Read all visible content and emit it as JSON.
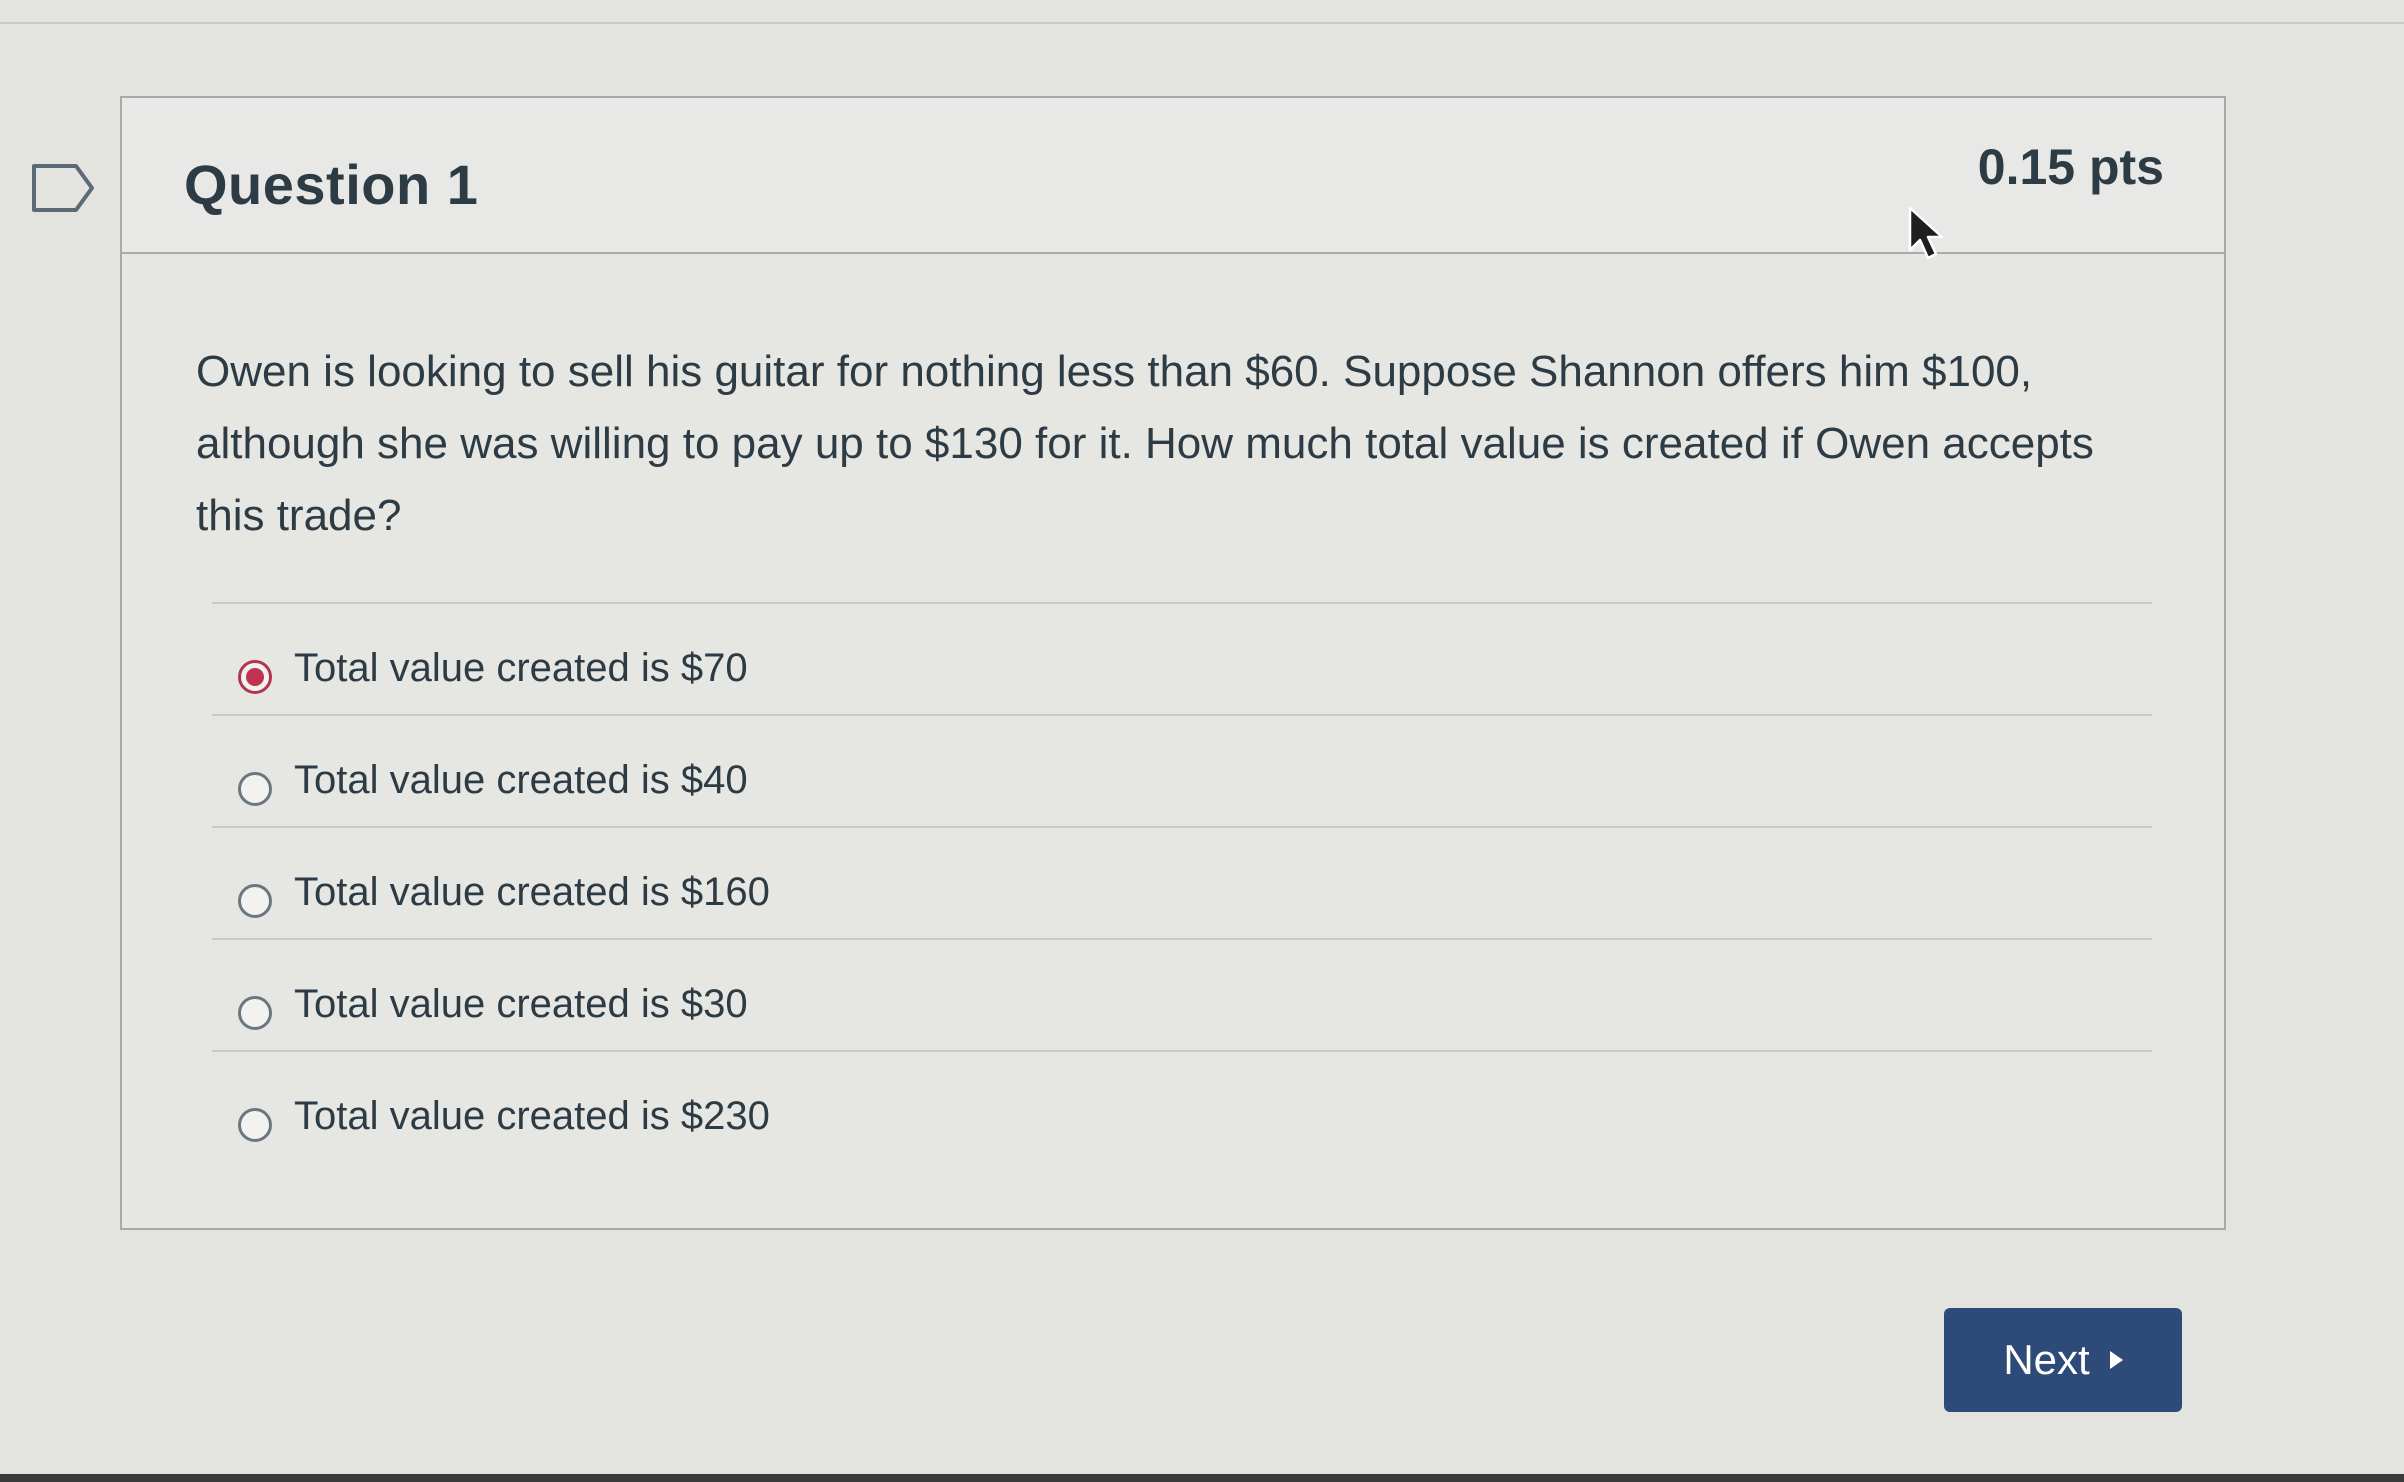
{
  "question": {
    "title": "Question 1",
    "points": "0.15 pts",
    "text": "Owen is looking to sell his guitar for nothing less than $60.  Suppose Shannon offers him $100, although she was willing to pay up to $130 for it.  How much total value is created if Owen accepts this trade?"
  },
  "answers": [
    {
      "label": "Total value created is $70",
      "selected": true
    },
    {
      "label": "Total value created is $40",
      "selected": false
    },
    {
      "label": "Total value created is $160",
      "selected": false
    },
    {
      "label": "Total value created is $30",
      "selected": false
    },
    {
      "label": "Total value created is $230",
      "selected": false
    }
  ],
  "navigation": {
    "next_label": "Next"
  },
  "colors": {
    "selected_radio": "#c0324f",
    "next_button": "#2e4a78",
    "text": "#2d3b45"
  },
  "icons": {
    "flag": "flag-icon",
    "next_caret": "caret-right-icon",
    "cursor": "cursor-icon"
  }
}
